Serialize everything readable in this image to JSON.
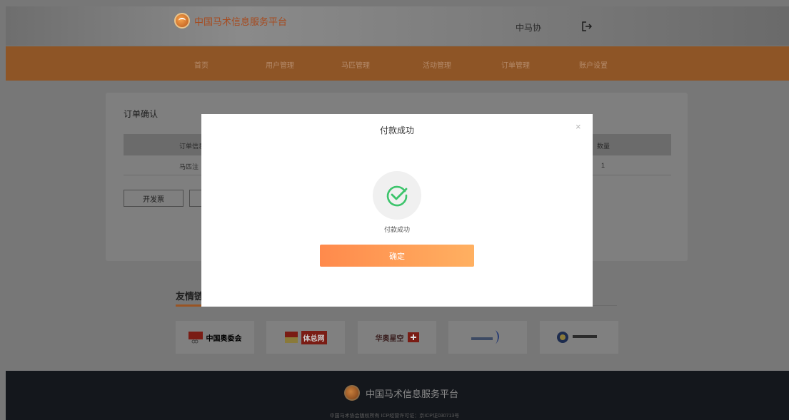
{
  "header": {
    "site_title": "中国马术信息服务平台",
    "user_name": "中马协",
    "icons": {
      "logo": "logo-icon",
      "logout": "logout-icon"
    }
  },
  "nav": {
    "items": [
      {
        "label": "首页"
      },
      {
        "label": "用户管理"
      },
      {
        "label": "马匹管理"
      },
      {
        "label": "活动管理"
      },
      {
        "label": "订单管理"
      },
      {
        "label": "账户设置"
      }
    ]
  },
  "order": {
    "title": "订单确认",
    "columns": [
      "订单信息",
      "数量"
    ],
    "row": {
      "item": "马匹注",
      "quantity": "1"
    },
    "invoice_button": "开发票"
  },
  "links": {
    "title": "友情链",
    "tiles": [
      {
        "label": "中国奥委会"
      },
      {
        "label": "体总网"
      },
      {
        "label": "华奥星空"
      },
      {
        "label": ""
      },
      {
        "label": ""
      }
    ]
  },
  "footer": {
    "site_title": "中国马术信息服务平台",
    "copyright": "中国马术协会版权所有  ICP经营许可证：京ICP证030713号"
  },
  "modal": {
    "title": "付款成功",
    "close_icon": "close-icon",
    "status_text": "付款成功",
    "confirm_label": "确定",
    "success_icon": "check-circle-icon",
    "colors": {
      "confirm_start": "#ff8a4c",
      "confirm_end": "#ffb061",
      "success_green": "#3cc46b"
    }
  }
}
